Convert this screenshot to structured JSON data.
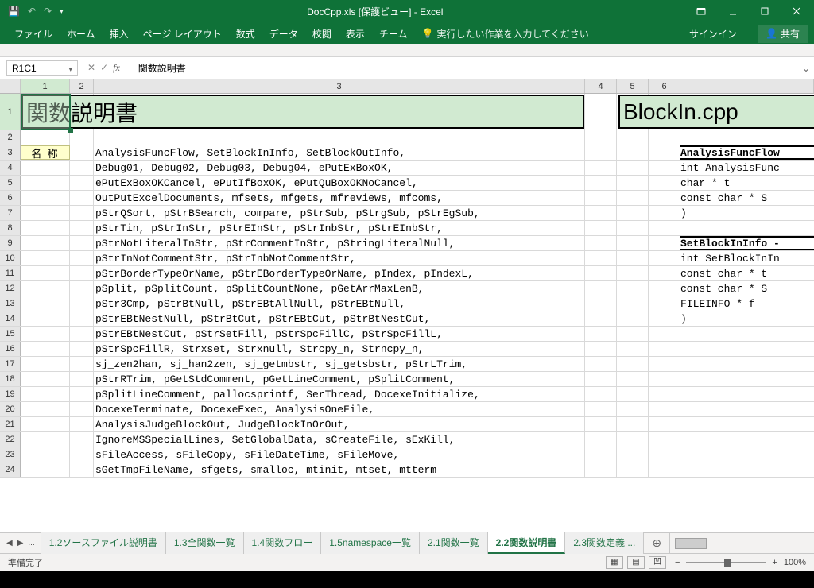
{
  "title": "DocCpp.xls  [保護ビュー] - Excel",
  "ribbon": {
    "tabs": [
      "ファイル",
      "ホーム",
      "挿入",
      "ページ レイアウト",
      "数式",
      "データ",
      "校閲",
      "表示",
      "チーム"
    ],
    "tellme": "実行したい作業を入力してください",
    "signin": "サインイン",
    "share": "共有"
  },
  "formula": {
    "name": "R1C1",
    "value": "関数説明書"
  },
  "colheads": [
    "1",
    "2",
    "3",
    "4",
    "5",
    "6"
  ],
  "big1": "関数説明書",
  "big2": "BlockIn.cpp",
  "name_label": "名 称",
  "lines": [
    "AnalysisFuncFlow, SetBlockInInfo, SetBlockOutInfo,",
    "Debug01, Debug02, Debug03, Debug04, ePutExBoxOK,",
    "ePutExBoxOKCancel, ePutIfBoxOK, ePutQuBoxOKNoCancel,",
    "OutPutExcelDocuments, mfsets, mfgets, mfreviews, mfcoms,",
    "pStrQSort, pStrBSearch, compare, pStrSub, pStrgSub, pStrEgSub,",
    "pStrTin, pStrInStr, pStrEInStr, pStrInbStr, pStrEInbStr,",
    "pStrNotLiteralInStr, pStrCommentInStr, pStringLiteralNull,",
    "pStrInNotCommentStr, pStrInbNotCommentStr,",
    "pStrBorderTypeOrName, pStrEBorderTypeOrName, pIndex, pIndexL,",
    "pSplit, pSplitCount, pSplitCountNone, pGetArrMaxLenB,",
    "pStr3Cmp, pStrBtNull, pStrEBtAllNull, pStrEBtNull,",
    "pStrEBtNestNull, pStrBtCut, pStrEBtCut, pStrBtNestCut,",
    "pStrEBtNestCut, pStrSetFill, pStrSpcFillC, pStrSpcFillL,",
    "pStrSpcFillR, Strxset, Strxnull, Strcpy_n, Strncpy_n,",
    "sj_zen2han, sj_han2zen, sj_getmbstr, sj_getsbstr, pStrLTrim,",
    "pStrRTrim, pGetStdComment, pGetLineComment, pSplitComment,",
    "pSplitLineComment, pallocsprintf, SerThread, DocexeInitialize,",
    "DocexeTerminate, DocexeExec, AnalysisOneFile,",
    "AnalysisJudgeBlockOut, JudgeBlockInOrOut,",
    "IgnoreMSSpecialLines, SetGlobalData, sCreateFile, sExKill,",
    "sFileAccess, sFileCopy, sFileDateTime, sFileMove,",
    "sGetTmpFileName, sfgets, smalloc, mtinit, mtset, mtterm"
  ],
  "right": [
    {
      "t": "hdr",
      "v": "AnalysisFuncFlow"
    },
    {
      "t": "row",
      "v": "int AnalysisFunc"
    },
    {
      "t": "row",
      "v": "  char *        t"
    },
    {
      "t": "row",
      "v": "  const char * S"
    },
    {
      "t": "row",
      "v": ")"
    },
    {
      "t": "gap",
      "v": ""
    },
    {
      "t": "hdr",
      "v": "SetBlockInInfo -"
    },
    {
      "t": "row",
      "v": "int SetBlockInIn"
    },
    {
      "t": "row",
      "v": "  const char * t"
    },
    {
      "t": "row",
      "v": "  const char * S"
    },
    {
      "t": "row",
      "v": "  FILEINFO *   f"
    },
    {
      "t": "row",
      "v": ")"
    }
  ],
  "sheets": {
    "tabs": [
      "1.2ソースファイル説明書",
      "1.3全関数一覧",
      "1.4関数フロー",
      "1.5namespace一覧",
      "2.1関数一覧",
      "2.2関数説明書",
      "2.3関数定義 ..."
    ],
    "active": 5
  },
  "status": {
    "ready": "準備完了",
    "zoom": "100%"
  }
}
